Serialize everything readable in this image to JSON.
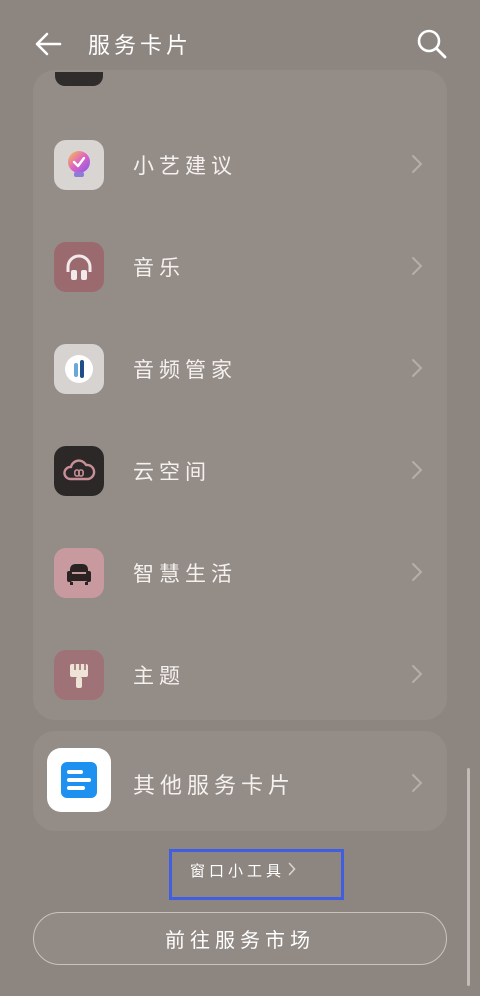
{
  "header": {
    "title": "服务卡片",
    "back_icon": "arrow-left-icon",
    "search_icon": "search-icon"
  },
  "apps": [
    {
      "label": "小艺建议",
      "icon": "xiaoyi-suggestion-icon",
      "color": "#d9d5d2"
    },
    {
      "label": "音乐",
      "icon": "headphones-icon",
      "color": "#9a6a6e"
    },
    {
      "label": "音频管家",
      "icon": "audio-manager-icon",
      "color": "#d6d3d1"
    },
    {
      "label": "云空间",
      "icon": "cloud-icon",
      "color": "#2b2827"
    },
    {
      "label": "智慧生活",
      "icon": "sofa-icon",
      "color": "#c89aa0"
    },
    {
      "label": "主题",
      "icon": "brush-icon",
      "color": "#9e7276"
    }
  ],
  "other_cards": {
    "label": "其他服务卡片",
    "icon": "service-card-icon",
    "color": "#1e90f0"
  },
  "widgets_link": {
    "label": "窗口小工具"
  },
  "market_button": {
    "label": "前往服务市场"
  }
}
